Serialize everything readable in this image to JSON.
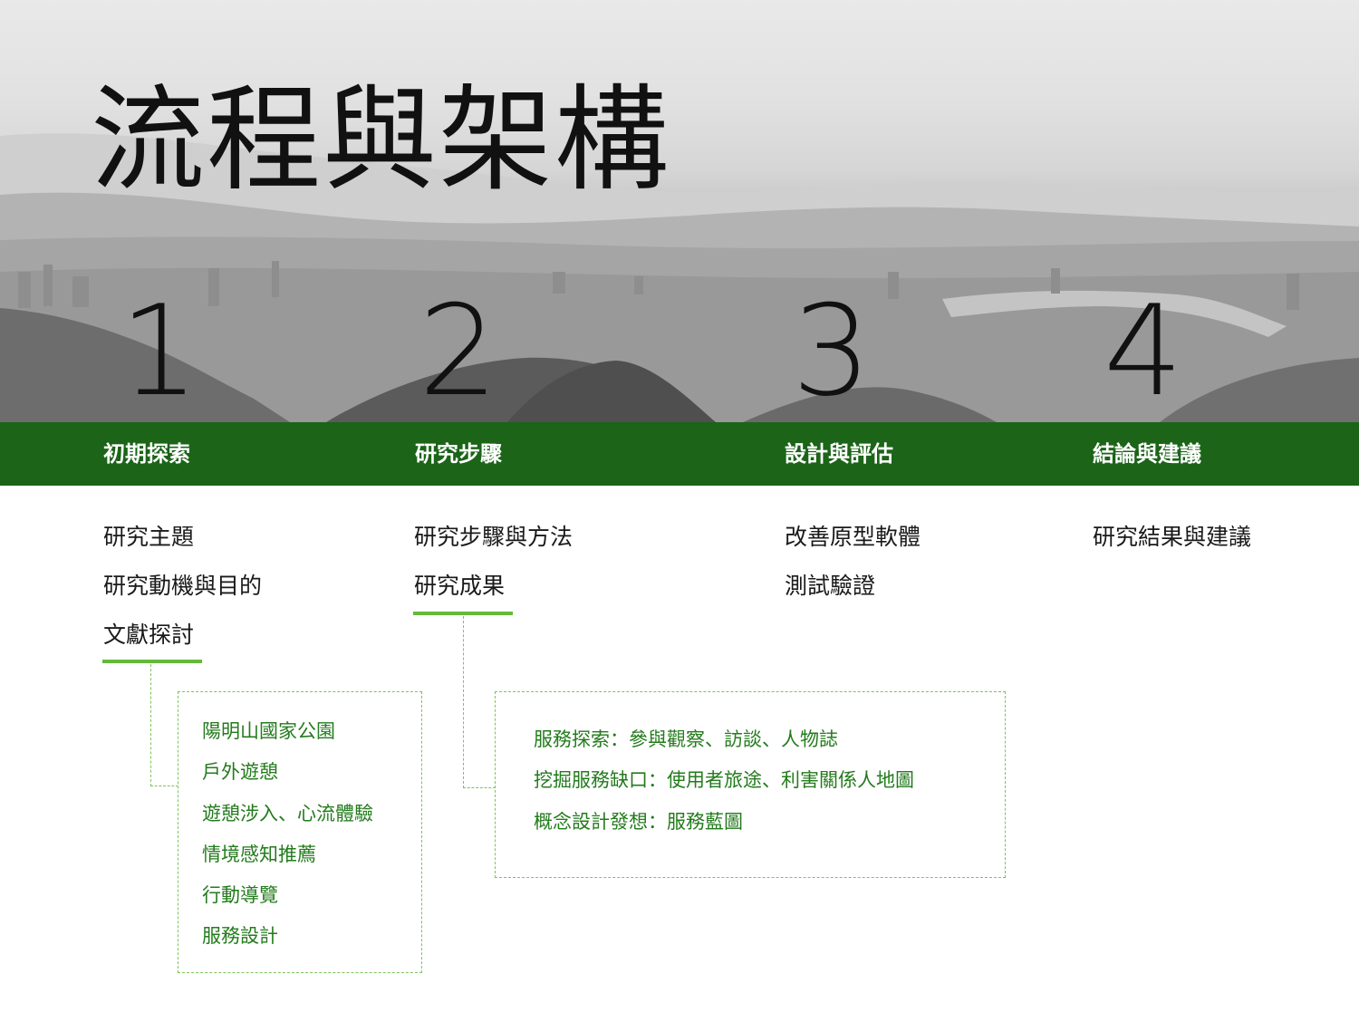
{
  "title": "流程與架構",
  "steps": [
    {
      "number": "1",
      "phase": "初期探索",
      "topics": [
        "研究主題",
        "研究動機與目的",
        "文獻探討"
      ],
      "details": [
        "陽明山國家公園",
        "戶外遊憩",
        "遊憩涉入、心流體驗",
        "情境感知推薦",
        "行動導覽",
        "服務設計"
      ]
    },
    {
      "number": "2",
      "phase": "研究步驟",
      "topics": [
        "研究步驟與方法",
        "研究成果"
      ],
      "details": [
        "服務探索：參與觀察、訪談、人物誌",
        "挖掘服務缺口：使用者旅途、利害關係人地圖",
        "概念設計發想：服務藍圖"
      ]
    },
    {
      "number": "3",
      "phase": "設計與評估",
      "topics": [
        "改善原型軟體",
        "測試驗證"
      ]
    },
    {
      "number": "4",
      "phase": "結論與建議",
      "topics": [
        "研究結果與建議"
      ]
    }
  ],
  "colors": {
    "band": "#1b6418",
    "underline": "#64ba3c",
    "detail_text": "#237b1c",
    "dashed": "#7cc45a"
  }
}
